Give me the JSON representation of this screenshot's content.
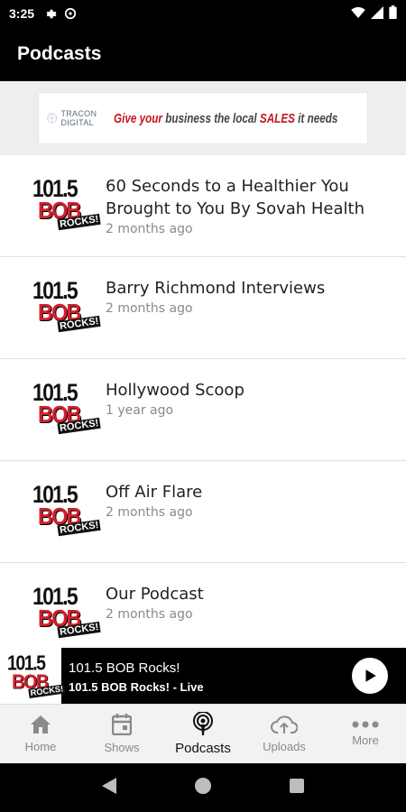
{
  "status_bar": {
    "time": "3:25"
  },
  "app_bar": {
    "title": "Podcasts"
  },
  "banner": {
    "brand": "TRACON DIGITAL",
    "tagline_part1": "Give your",
    "tagline_part2": " business the local ",
    "tagline_part3": "SALES",
    "tagline_part4": " it needs"
  },
  "logo": {
    "number": "101.5",
    "name": "BOB",
    "sub": "ROCKS!"
  },
  "podcasts": [
    {
      "title": "60 Seconds to a Healthier You Brought to You By Sovah Health",
      "meta": "2 months ago"
    },
    {
      "title": "Barry Richmond Interviews",
      "meta": "2 months ago"
    },
    {
      "title": "Hollywood Scoop",
      "meta": "1 year ago"
    },
    {
      "title": "Off Air Flare",
      "meta": "2 months ago"
    },
    {
      "title": "Our Podcast",
      "meta": "2 months ago"
    }
  ],
  "player": {
    "title": "101.5 BOB Rocks!",
    "subtitle": "101.5 BOB Rocks! - Live"
  },
  "bottom_nav": [
    {
      "label": "Home",
      "icon": "home-icon"
    },
    {
      "label": "Shows",
      "icon": "calendar-icon"
    },
    {
      "label": "Podcasts",
      "icon": "podcast-icon",
      "active": true
    },
    {
      "label": "Uploads",
      "icon": "cloud-upload-icon"
    },
    {
      "label": "More",
      "icon": "more-icon"
    }
  ]
}
